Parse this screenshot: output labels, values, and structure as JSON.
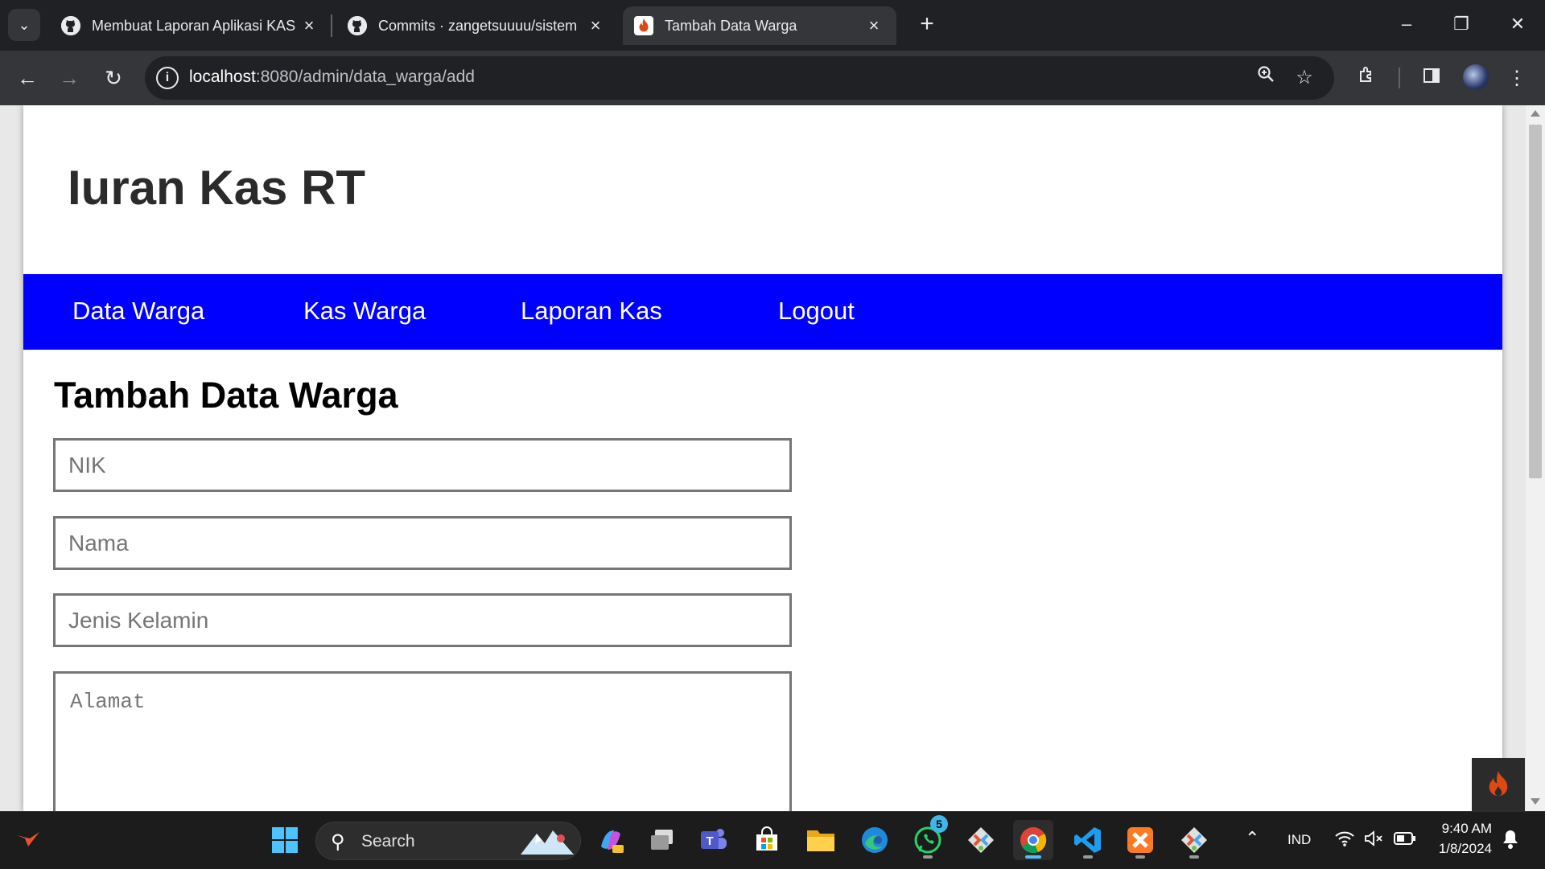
{
  "browser": {
    "tabs": [
      {
        "title": "Membuat Laporan Aplikasi KAS",
        "icon": "github-icon",
        "active": false
      },
      {
        "title": "Commits · zangetsuuuu/sistem",
        "icon": "github-icon",
        "active": false
      },
      {
        "title": "Tambah Data Warga",
        "icon": "codeigniter-icon",
        "active": true
      }
    ],
    "url_host": "localhost",
    "url_path": ":8080/admin/data_warga/add"
  },
  "site": {
    "title": "Iuran Kas RT",
    "nav": [
      "Data Warga",
      "Kas Warga",
      "Laporan Kas",
      "Logout"
    ],
    "nav_color": "#0000ff"
  },
  "form": {
    "heading": "Tambah Data Warga",
    "nik_placeholder": "NIK",
    "nama_placeholder": "Nama",
    "jenis_kelamin_placeholder": "Jenis Kelamin",
    "alamat_placeholder": "Alamat"
  },
  "taskbar": {
    "search_label": "Search",
    "whatsapp_badge": "5",
    "language": "IND",
    "time": "9:40 AM",
    "date": "1/8/2024"
  }
}
